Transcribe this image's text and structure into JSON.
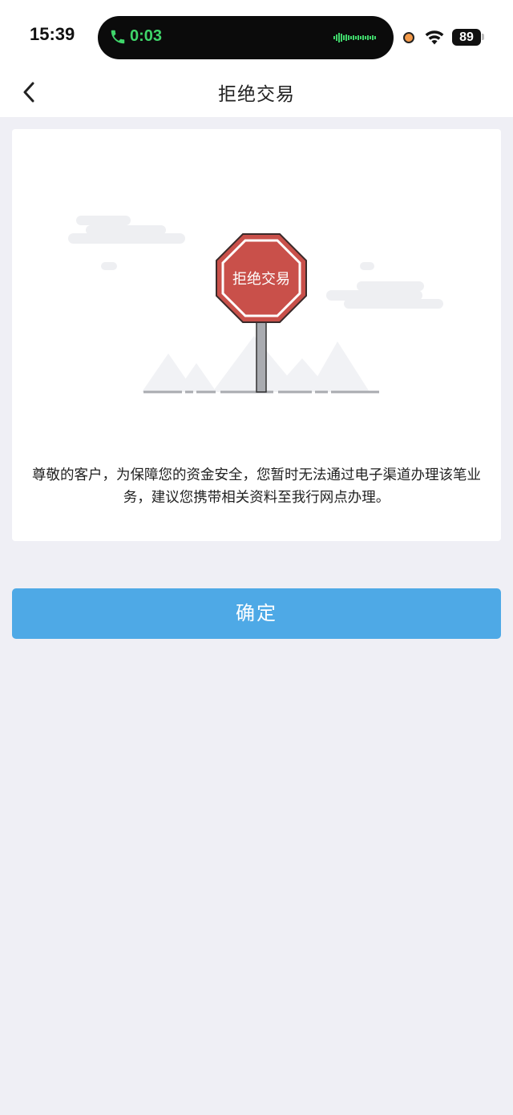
{
  "status_bar": {
    "time": "15:39",
    "call_timer": "0:03",
    "battery": "89",
    "icons": [
      "phone-icon",
      "waveform-icon",
      "recording-dot-icon",
      "wifi-icon",
      "battery-icon"
    ]
  },
  "nav": {
    "title": "拒绝交易",
    "back_icon": "chevron-left-icon"
  },
  "card": {
    "sign_text": "拒绝交易",
    "message": "尊敬的客户，为保障您的资金安全，您暂时无法通过电子渠道办理该笔业务，建议您携带相关资料至我行网点办理。"
  },
  "confirm_label": "确定",
  "colors": {
    "accent": "#4ea9e6",
    "sign_red": "#c9504a",
    "background": "#efeff5",
    "call_green": "#3fd66a"
  }
}
